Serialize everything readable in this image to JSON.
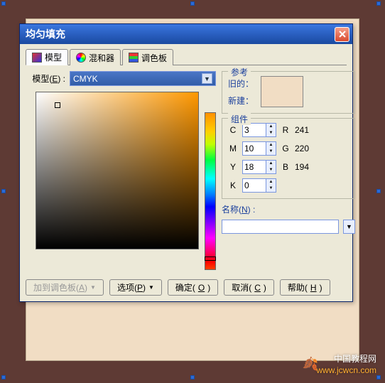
{
  "dialog": {
    "title": "均匀填充",
    "tabs": [
      {
        "label": "模型",
        "icon": "model"
      },
      {
        "label": "混和器",
        "icon": "mixer"
      },
      {
        "label": "调色板",
        "icon": "palette"
      }
    ],
    "model_label": "模型(E) :",
    "model_value": "CMYK"
  },
  "reference": {
    "legend": "参考",
    "old_label": "旧的：",
    "new_label": "新建：",
    "swatch_color": "#f1ddc4"
  },
  "components": {
    "legend": "组件",
    "cmyk": [
      {
        "ch": "C",
        "val": "3"
      },
      {
        "ch": "M",
        "val": "10"
      },
      {
        "ch": "Y",
        "val": "18"
      },
      {
        "ch": "K",
        "val": "0"
      }
    ],
    "rgb": [
      {
        "ch": "R",
        "val": "241"
      },
      {
        "ch": "G",
        "val": "220"
      },
      {
        "ch": "B",
        "val": "194"
      }
    ]
  },
  "name": {
    "label": "名称(N) :",
    "value": ""
  },
  "buttons": {
    "add_palette": "加到调色板(A)",
    "options": "选项(P)",
    "ok": "确定(O)",
    "cancel": "取消(C)",
    "help": "帮助(H)"
  },
  "watermark": {
    "line1": "中国教程网",
    "url": "www.jcwcn.com"
  }
}
